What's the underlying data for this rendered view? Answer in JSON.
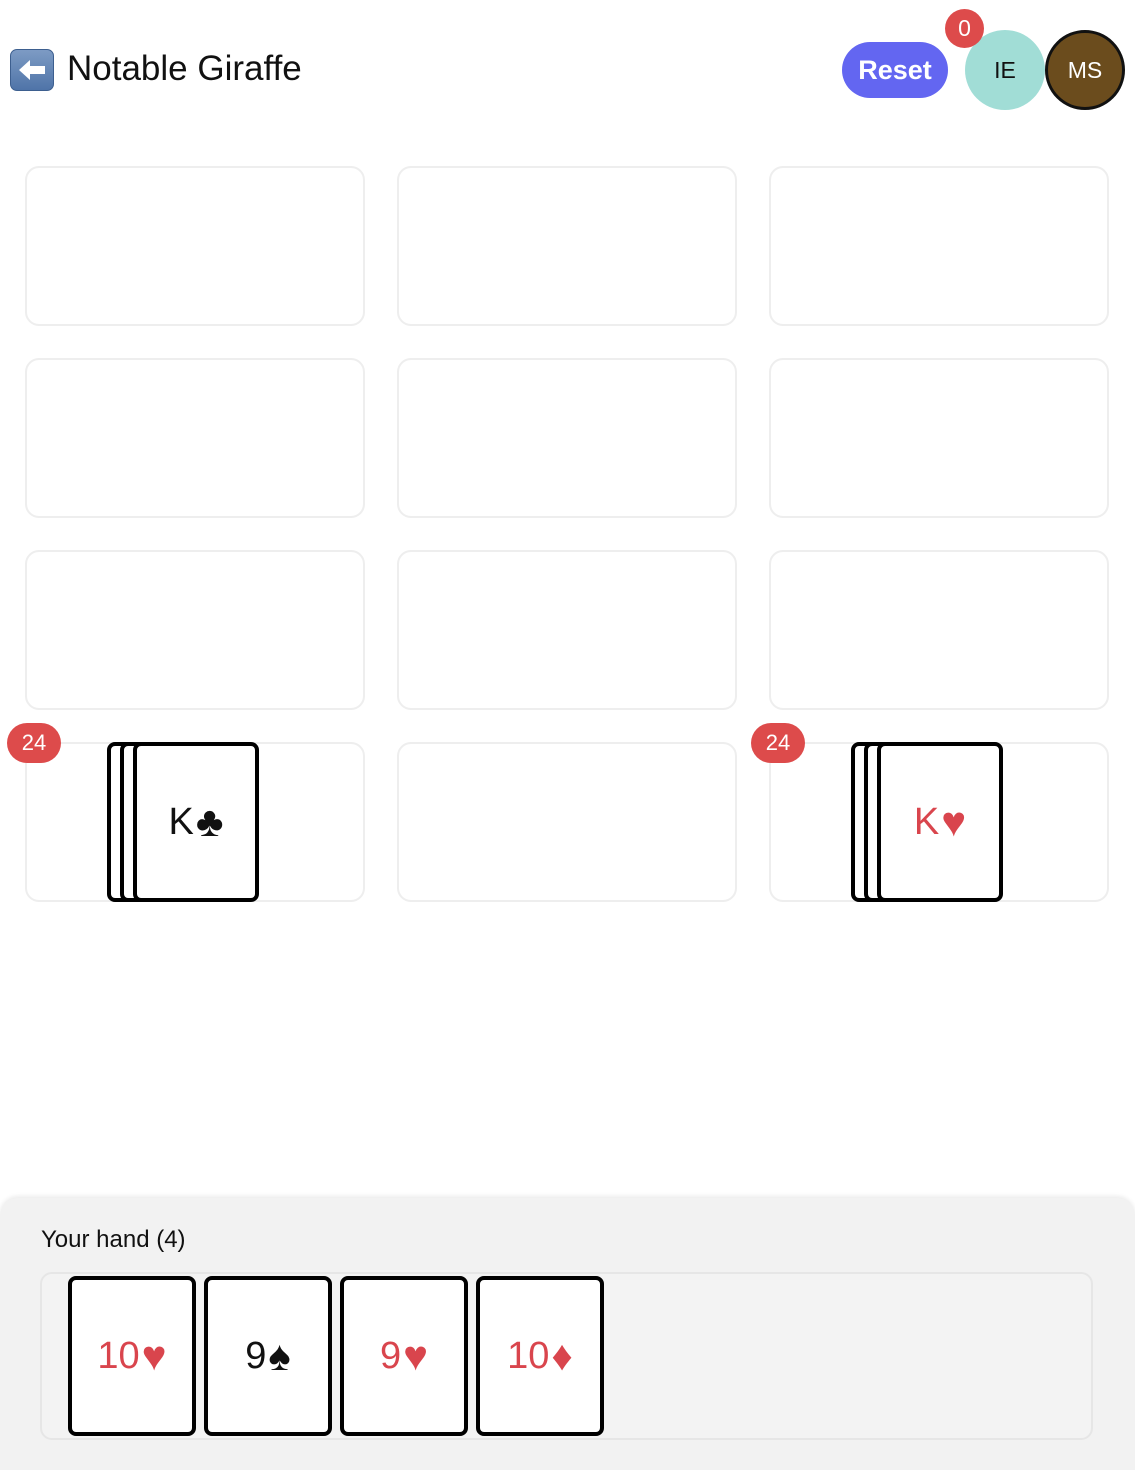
{
  "header": {
    "title": "Notable Giraffe",
    "back_icon": "back-arrow-icon",
    "reset_label": "Reset",
    "notification_count": "0",
    "players": [
      {
        "initials": "IE",
        "color": "#a1ddd6"
      },
      {
        "initials": "MS",
        "color": "#6b4c1d"
      }
    ]
  },
  "board": {
    "rows": 4,
    "columns": 3,
    "piles": [
      {
        "slot": "row4-col1",
        "count": "24",
        "top_card": {
          "rank": "K",
          "suit": "♣",
          "suit_name": "clubs",
          "color": "black"
        }
      },
      {
        "slot": "row4-col3",
        "count": "24",
        "top_card": {
          "rank": "K",
          "suit": "♥",
          "suit_name": "hearts",
          "color": "red"
        }
      }
    ]
  },
  "hand": {
    "label": "Your hand (4)",
    "cards": [
      {
        "rank": "10",
        "suit": "♥",
        "suit_name": "hearts",
        "color": "red"
      },
      {
        "rank": "9",
        "suit": "♠",
        "suit_name": "spades",
        "color": "black"
      },
      {
        "rank": "9",
        "suit": "♥",
        "suit_name": "hearts",
        "color": "red"
      },
      {
        "rank": "10",
        "suit": "♦",
        "suit_name": "diamonds",
        "color": "red"
      }
    ]
  },
  "colors": {
    "accent": "#6366f1",
    "badge": "#dd4b4b",
    "red_suit": "#d9454d"
  }
}
